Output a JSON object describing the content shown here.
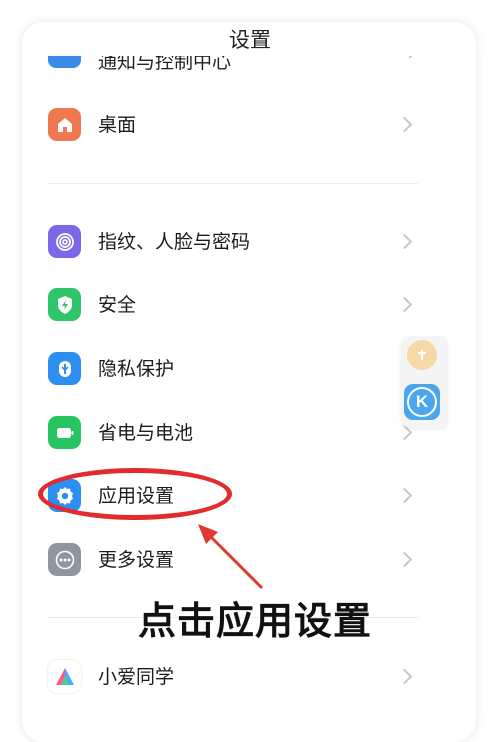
{
  "header": {
    "title": "设置"
  },
  "cut_row": {
    "label": "通知与控制中心"
  },
  "items": [
    {
      "label": "桌面",
      "icon": "home-icon",
      "color": "#f07850"
    },
    {
      "label": "指纹、人脸与密码",
      "icon": "fingerprint-icon",
      "color": "#7b68e6"
    },
    {
      "label": "安全",
      "icon": "shield-lightning-icon",
      "color": "#2ec56b"
    },
    {
      "label": "隐私保护",
      "icon": "privacy-icon",
      "color": "#2d8ff0"
    },
    {
      "label": "省电与电池",
      "icon": "battery-icon",
      "color": "#27c561"
    },
    {
      "label": "应用设置",
      "icon": "gear-icon",
      "color": "#2d8ff0"
    },
    {
      "label": "更多设置",
      "icon": "more-dots-icon",
      "color": "#8e96a3"
    },
    {
      "label": "小爱同学",
      "icon": "xiaoai-icon",
      "color": "#ffffff"
    }
  ],
  "floating_ball": {
    "letter": "K",
    "top_icon": "pin-icon",
    "accent": "#4aa6ee"
  },
  "annotation": {
    "text": "点击应用设置",
    "color": "#e02c2c"
  }
}
